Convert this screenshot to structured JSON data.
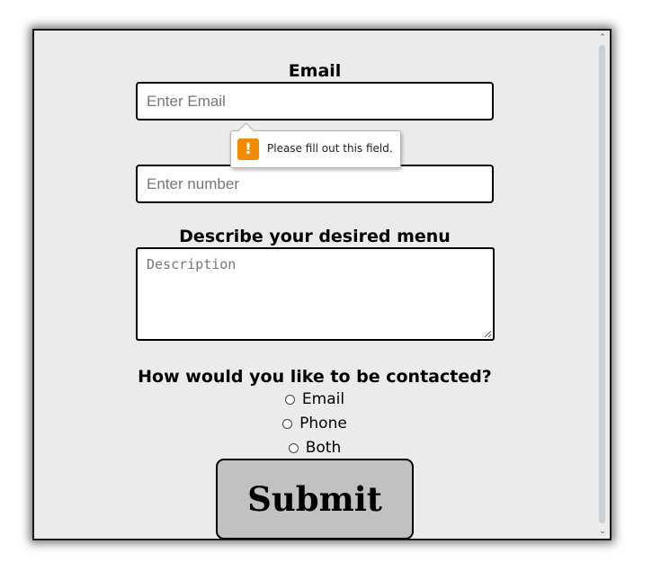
{
  "form": {
    "email_label": "Email",
    "email_placeholder": "Enter Email",
    "phone_placeholder": "Enter number",
    "description_label": "Describe your desired menu",
    "description_placeholder": "Description",
    "contact_question": "How would you like to be contacted?",
    "contact_options": [
      "Email",
      "Phone",
      "Both"
    ],
    "submit_label": "Submit"
  },
  "validation_tooltip": {
    "icon": "warning-icon",
    "icon_glyph": "!",
    "message": "Please fill out this field."
  },
  "scrollbar": {
    "up_glyph": "⌃",
    "down_glyph": "⌄"
  },
  "colors": {
    "page_background": "#ebebeb",
    "warning_accent": "#f28b00",
    "submit_background": "#c1c1c1"
  }
}
